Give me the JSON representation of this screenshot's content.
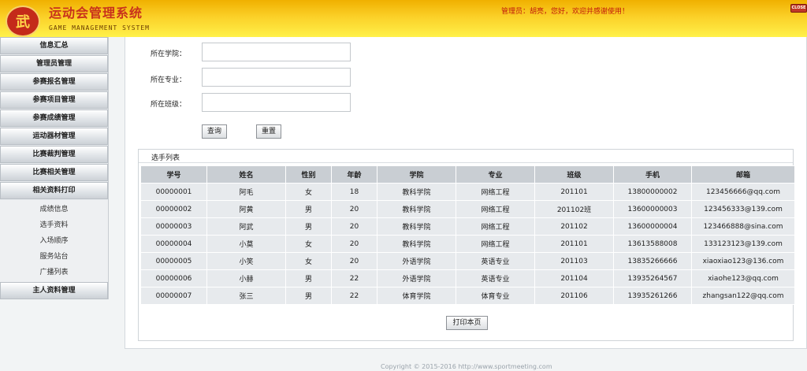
{
  "header": {
    "logo_glyph": "武",
    "title": "运动会管理系统",
    "subtitle": "GAME MANAGEMENT SYSTEM",
    "welcome": "管理员：胡亮，您好，欢迎并感谢使用！",
    "close_label": "CLOSE"
  },
  "sidebar": {
    "items": [
      {
        "label": "信息汇总"
      },
      {
        "label": "管理员管理"
      },
      {
        "label": "参赛报名管理"
      },
      {
        "label": "参赛项目管理"
      },
      {
        "label": "参赛成绩管理"
      },
      {
        "label": "运动器材管理"
      },
      {
        "label": "比赛裁判管理"
      },
      {
        "label": "比赛相关管理"
      },
      {
        "label": "相关资料打印"
      }
    ],
    "sub_items": [
      {
        "label": "成绩信息"
      },
      {
        "label": "选手资料"
      },
      {
        "label": "入场顺序"
      },
      {
        "label": "服务站台"
      },
      {
        "label": "广播列表"
      }
    ],
    "last_item": {
      "label": "主人资料管理"
    }
  },
  "filters": {
    "college_label": "所在学院：",
    "major_label": "所在专业：",
    "class_label": "所在班级：",
    "college_value": "",
    "major_value": "",
    "class_value": "",
    "search_label": "查询",
    "reset_label": "重置"
  },
  "panel": {
    "title": "选手列表",
    "print_label": "打印本页"
  },
  "table": {
    "headers": [
      "学号",
      "姓名",
      "性别",
      "年龄",
      "学院",
      "专业",
      "班级",
      "手机",
      "邮箱"
    ],
    "rows": [
      [
        "00000001",
        "阿毛",
        "女",
        "18",
        "教科学院",
        "网络工程",
        "201101",
        "13800000002",
        "123456666@qq.com"
      ],
      [
        "00000002",
        "阿黄",
        "男",
        "20",
        "教科学院",
        "网络工程",
        "201102班",
        "13600000003",
        "123456333@139.com"
      ],
      [
        "00000003",
        "阿武",
        "男",
        "20",
        "教科学院",
        "网络工程",
        "201102",
        "13600000004",
        "123466888@sina.com"
      ],
      [
        "00000004",
        "小莫",
        "女",
        "20",
        "教科学院",
        "网络工程",
        "201101",
        "13613588008",
        "133123123@139.com"
      ],
      [
        "00000005",
        "小笑",
        "女",
        "20",
        "外语学院",
        "英语专业",
        "201103",
        "13835266666",
        "xiaoxiao123@136.com"
      ],
      [
        "00000006",
        "小赫",
        "男",
        "22",
        "外语学院",
        "英语专业",
        "201104",
        "13935264567",
        "xiaohe123@qq.com"
      ],
      [
        "00000007",
        "张三",
        "男",
        "22",
        "体育学院",
        "体育专业",
        "201106",
        "13935261266",
        "zhangsan122@qq.com"
      ]
    ]
  },
  "footer": {
    "copyright": "Copyright © 2015-2016 http://www.sportmeeting.com"
  }
}
